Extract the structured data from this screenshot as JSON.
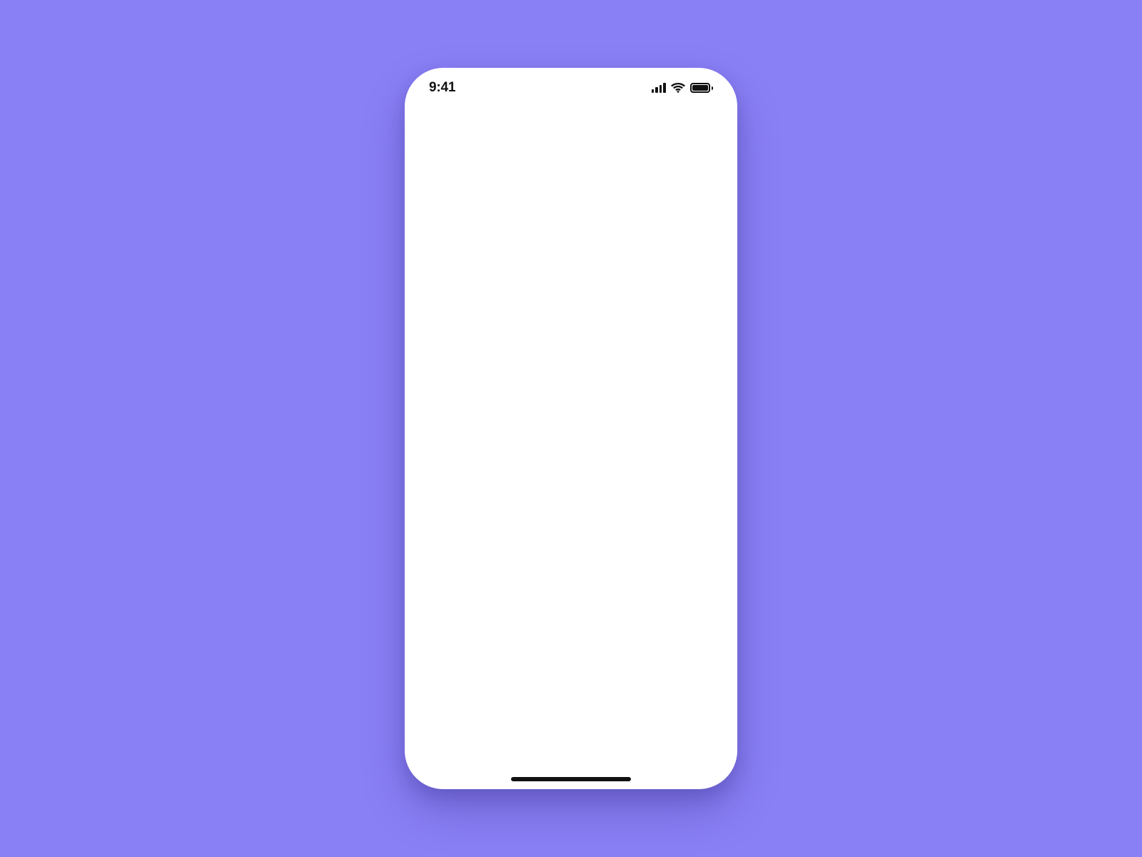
{
  "colors": {
    "background": "#8A80F6",
    "device_surface": "#FFFFFF",
    "foreground": "#111111"
  },
  "status_bar": {
    "time": "9:41",
    "icons": {
      "signal": "cellular-signal-icon",
      "wifi": "wifi-icon",
      "battery": "battery-icon"
    }
  }
}
